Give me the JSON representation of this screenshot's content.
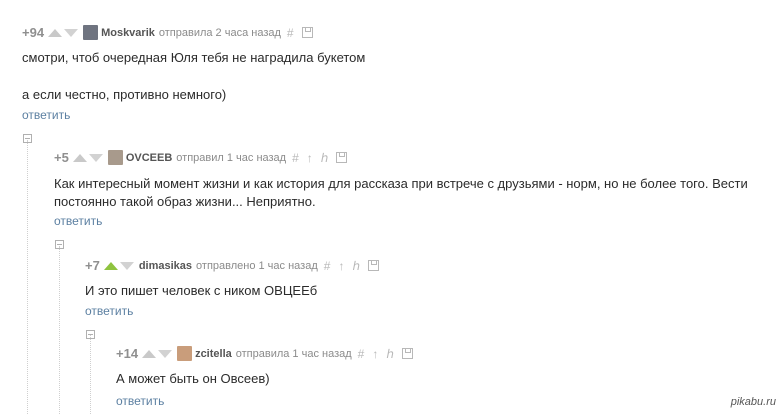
{
  "comments": [
    {
      "rating": "+94",
      "username": "Moskvarik",
      "time": "отправила 2 часа назад",
      "lines": [
        "смотри, чтоб очередная Юля тебя не наградила букетом",
        "а если честно, противно немного)"
      ],
      "reply": "ответить",
      "avatar_color": "#6f7480"
    },
    {
      "rating": "+5",
      "username": "OVCEEB",
      "time": "отправил 1 час назад",
      "lines": [
        "Как интересный момент жизни и как история для рассказа при встрече с друзьями - норм, но не более того. Вести",
        "постоянно такой образ жизни... Неприятно."
      ],
      "reply": "ответить",
      "avatar_color": "#a89a8c"
    },
    {
      "rating": "+7",
      "username": "dimasikas",
      "time": "отправлено 1 час назад",
      "lines": [
        "И это пишет человек с ником ОВЦЕЕб"
      ],
      "reply": "ответить"
    },
    {
      "rating": "+14",
      "username": "zcitella",
      "time": "отправила 1 час назад",
      "lines": [
        "А может быть он Овсеев)"
      ],
      "reply": "ответить",
      "avatar_color": "#c99d7b"
    }
  ],
  "icons": {
    "link": "#",
    "up": "↑",
    "branch": "ℎ"
  },
  "watermark": "pikabu.ru",
  "colors": {
    "vote_up_active": "#8fc33f",
    "link": "#5b7fa1"
  }
}
